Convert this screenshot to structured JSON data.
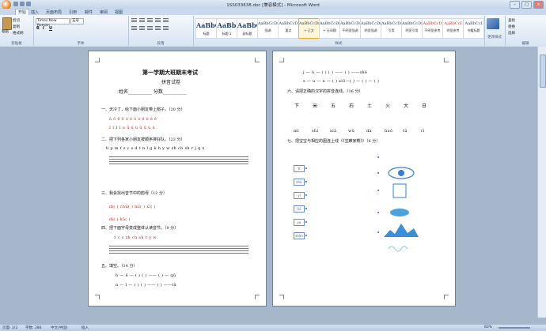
{
  "window": {
    "title": "1SS033638.doc [兼容模式] - Microsoft Word",
    "buttons": [
      "–",
      "□",
      "×"
    ]
  },
  "tabs": [
    "开始",
    "插入",
    "页面布局",
    "引用",
    "邮件",
    "审阅",
    "视图"
  ],
  "ribbon": {
    "clipboard": {
      "paste": "粘贴",
      "cut": "剪切",
      "copy": "复制",
      "format_painter": "格式刷",
      "label": "剪贴板"
    },
    "font": {
      "name": "Times New Roman",
      "size": "五号",
      "bold": "B",
      "italic": "I",
      "underline": "U",
      "label": "字体"
    },
    "paragraph": {
      "label": "段落"
    },
    "styles": {
      "label": "样式",
      "items": [
        {
          "sample": "AaBbC",
          "name": "标题",
          "big": true
        },
        {
          "sample": "AaBb",
          "name": "标题 1",
          "big": true
        },
        {
          "sample": "AaBbC",
          "name": "副标题",
          "big": true
        },
        {
          "sample": "AaBbCcDı",
          "name": "强调",
          "big": false
        },
        {
          "sample": "AaBbCcD",
          "name": "要点",
          "big": false
        },
        {
          "sample": "AaBbCcDı",
          "name": "+ 正文",
          "big": false,
          "selected": true
        },
        {
          "sample": "AaBbCcDı",
          "name": "+ 无间隔",
          "big": false
        },
        {
          "sample": "AaBbCcDı",
          "name": "不明显强调",
          "big": false
        },
        {
          "sample": "AaBbCcDı",
          "name": "明显强调",
          "big": false
        },
        {
          "sample": "AaBbCcDı",
          "name": "引用",
          "big": false
        },
        {
          "sample": "AaBbCcDı",
          "name": "明显引用",
          "big": false
        },
        {
          "sample": "AaBbCcD",
          "name": "不明显参考",
          "big": false,
          "red": true
        },
        {
          "sample": "AaBbCcI",
          "name": "明显参考",
          "big": false,
          "red": true
        },
        {
          "sample": "AaBbCcI",
          "name": "书籍标题",
          "big": false
        }
      ]
    },
    "change_styles": "更改样式",
    "editing": {
      "find": "查找",
      "replace": "替换",
      "select": "选择",
      "label": "编辑"
    }
  },
  "page1": {
    "title": "第一学期大班期末考试",
    "subtitle": "拼音试卷",
    "name_line": "姓名__________    分数__________",
    "q1": "一、天冷了，给下面小朋友带上帽子。（20 分）",
    "q1_row1": "ā   ō   ē   ō          ó   ó   ó   ó               ē   è   é   ě",
    "q1_row2": "I   I   I   I          u   ū   ú   ù               ǔ   ū   ù   ú",
    "q2": "二、把下列各家小朋友按顺序排好队。（23 分）",
    "q2_row": "b p m f    z c s    d t n l    g k h    y w    zh ch sh r    j q x",
    "q3": "三、我会找出音节中的韵母（12 分）",
    "q3_row1": "dì(      )     chū(      )     mǐ(      )     xǐ(      )",
    "q3_row2": "dì(      )     kǎ(      )",
    "q4": "四、把下面字母变成整体认读音节。（9 分）",
    "q4_row": "z     c     s     zh     ch     sh     r     y     w",
    "q5": "五、填空。（14 分）",
    "q5_row1": "b — ē — (    )                  (    ) —— (    ) — qū",
    "q5_row2": "n — ǐ — (    )                  (    ) —— (    ) ——lǜ"
  },
  "page2": {
    "row1": "j — ú — (    )                  (    ) —— (    ) ——shě",
    "row2": "s — u — a — (    )              xiō—(   ) — (   ) — (   )",
    "q6": "六、请把正确的汉字的拼音连线。（16 分）",
    "hanzi": [
      "下",
      "米",
      "五",
      "石",
      "土",
      "火",
      "大",
      "日"
    ],
    "pinyin": [
      "mǐ",
      "shí",
      "xiǎ",
      "wǔ",
      "dà",
      "huǒ",
      "tǔ",
      "rì"
    ],
    "q7": "七、把宝宝与相应的图连上线（《宝麒家樱》）（6 分）",
    "boxes": [
      "tī",
      "zhū",
      "yī",
      "bǐ",
      "yú",
      "shān"
    ]
  },
  "status": {
    "page": "页面: 2/2",
    "words": "字数: 286",
    "lang": "中文(中国)",
    "mode": "插入",
    "zoom": "80%"
  }
}
